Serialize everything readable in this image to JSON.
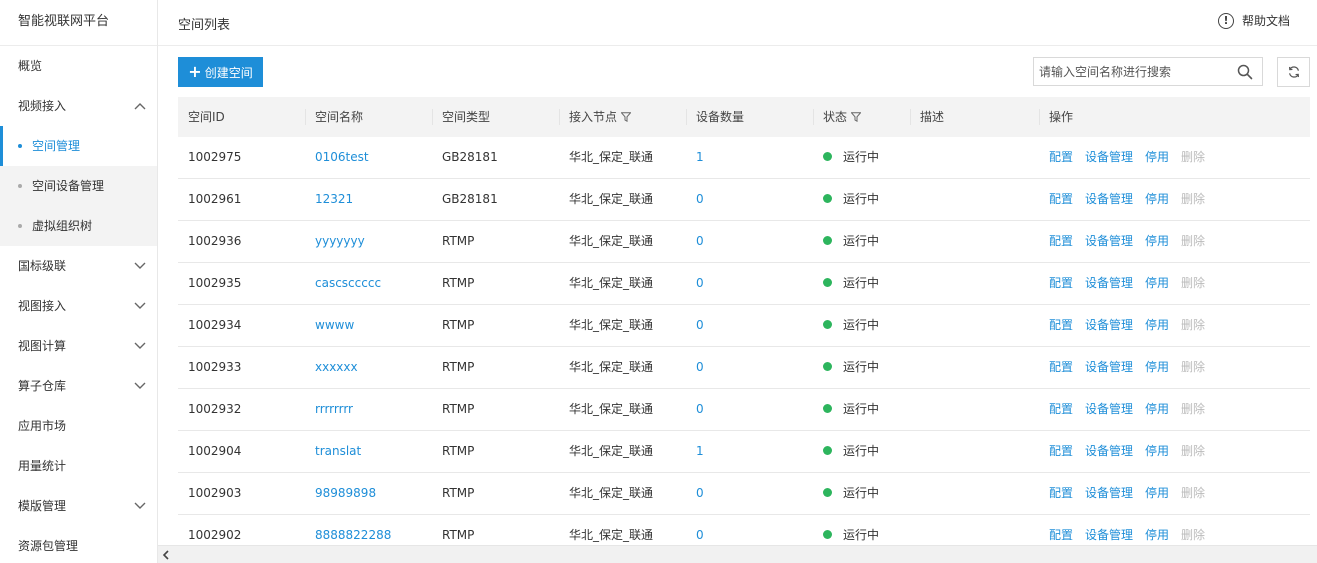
{
  "app": {
    "title": "智能视联网平台"
  },
  "sidebar": {
    "items": [
      {
        "label": "概览",
        "expandable": false
      },
      {
        "label": "视频接入",
        "expandable": true,
        "expanded": true
      },
      {
        "label": "国标级联",
        "expandable": true
      },
      {
        "label": "视图接入",
        "expandable": true
      },
      {
        "label": "视图计算",
        "expandable": true
      },
      {
        "label": "算子仓库",
        "expandable": true
      },
      {
        "label": "应用市场",
        "expandable": false
      },
      {
        "label": "用量统计",
        "expandable": false
      },
      {
        "label": "模版管理",
        "expandable": true
      },
      {
        "label": "资源包管理",
        "expandable": false
      }
    ],
    "subitems": [
      {
        "label": "空间管理",
        "active": true
      },
      {
        "label": "空间设备管理"
      },
      {
        "label": "虚拟组织树"
      }
    ]
  },
  "header": {
    "title": "空间列表",
    "help_label": "帮助文档"
  },
  "toolbar": {
    "create_label": "创建空间",
    "search_placeholder": "请输入空间名称进行搜索"
  },
  "table": {
    "columns": [
      "空间ID",
      "空间名称",
      "空间类型",
      "接入节点",
      "设备数量",
      "状态",
      "描述",
      "操作"
    ],
    "actions": {
      "config": "配置",
      "device": "设备管理",
      "stop": "停用",
      "delete": "删除"
    },
    "rows": [
      {
        "id": "1002975",
        "name": "0106test",
        "type": "GB28181",
        "node": "华北_保定_联通",
        "count": "1",
        "status": "运行中",
        "desc": ""
      },
      {
        "id": "1002961",
        "name": "12321",
        "type": "GB28181",
        "node": "华北_保定_联通",
        "count": "0",
        "status": "运行中",
        "desc": ""
      },
      {
        "id": "1002936",
        "name": "yyyyyyy",
        "type": "RTMP",
        "node": "华北_保定_联通",
        "count": "0",
        "status": "运行中",
        "desc": ""
      },
      {
        "id": "1002935",
        "name": "cascsccccc",
        "type": "RTMP",
        "node": "华北_保定_联通",
        "count": "0",
        "status": "运行中",
        "desc": ""
      },
      {
        "id": "1002934",
        "name": "wwww",
        "type": "RTMP",
        "node": "华北_保定_联通",
        "count": "0",
        "status": "运行中",
        "desc": ""
      },
      {
        "id": "1002933",
        "name": "xxxxxx",
        "type": "RTMP",
        "node": "华北_保定_联通",
        "count": "0",
        "status": "运行中",
        "desc": ""
      },
      {
        "id": "1002932",
        "name": "rrrrrrrr",
        "type": "RTMP",
        "node": "华北_保定_联通",
        "count": "0",
        "status": "运行中",
        "desc": ""
      },
      {
        "id": "1002904",
        "name": "translat",
        "type": "RTMP",
        "node": "华北_保定_联通",
        "count": "1",
        "status": "运行中",
        "desc": ""
      },
      {
        "id": "1002903",
        "name": "98989898",
        "type": "RTMP",
        "node": "华北_保定_联通",
        "count": "0",
        "status": "运行中",
        "desc": ""
      },
      {
        "id": "1002902",
        "name": "8888822288",
        "type": "RTMP",
        "node": "华北_保定_联通",
        "count": "0",
        "status": "运行中",
        "desc": ""
      }
    ]
  },
  "colors": {
    "accent": "#1e8ed8",
    "status_running": "#2db55d",
    "disabled": "#bbbbbb"
  }
}
